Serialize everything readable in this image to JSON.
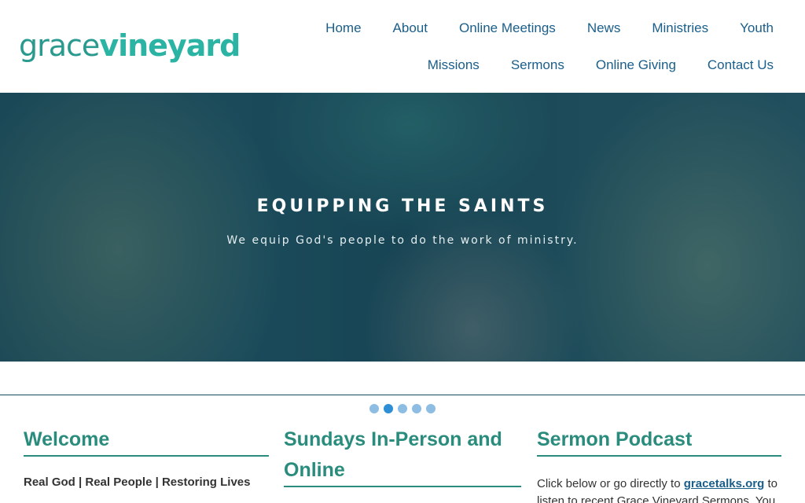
{
  "brand": {
    "logo_part1": "grace",
    "logo_part2": "vineyard",
    "accent_color": "#2a8c7c",
    "nav_color": "#1a5e8a"
  },
  "nav": {
    "row1": [
      "Home",
      "About",
      "Online Meetings",
      "News",
      "Ministries",
      "Youth"
    ],
    "row2": [
      "Missions",
      "Sermons",
      "Online Giving",
      "Contact Us"
    ]
  },
  "hero": {
    "title": "EQUIPPING THE SAINTS",
    "subtitle": "We equip God's people to do the work of ministry.",
    "slide_count": 5,
    "active_slide": 2
  },
  "columns": {
    "welcome": {
      "heading": "Welcome",
      "tagline": "Real God | Real People | Restoring Lives"
    },
    "sundays": {
      "heading_line1": "Sundays In-Person and",
      "heading_line2": "Online"
    },
    "podcast": {
      "heading": "Sermon Podcast",
      "text_before": "Click below or go directly to ",
      "link": "gracetalks.org",
      "text_after": " to listen to recent Grace Vineyard Sermons. You"
    }
  }
}
